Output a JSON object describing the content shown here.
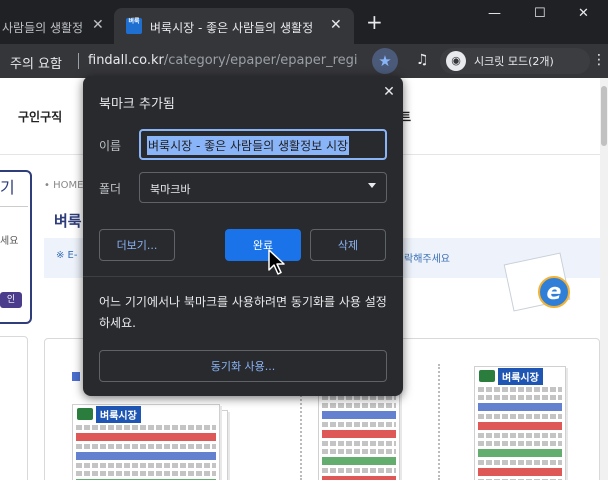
{
  "tabs": [
    {
      "title": "사람들의 생활정",
      "active": false
    },
    {
      "title": "벼룩시장 - 좋은 사람들의 생활정",
      "active": true,
      "favicon_text": "벼룩"
    }
  ],
  "toolbar": {
    "security_label": "주의 요함",
    "url_host": "findall.co.kr",
    "url_path": "/category/epaper/epaper_regi",
    "profile_label": "시크릿 모드(2개)"
  },
  "page": {
    "nav_job": "구인구직",
    "nav_event": "트",
    "breadcrumb": "• HOME",
    "section_title": "벼룩",
    "notice_prefix": "※ E-",
    "notice_suffix": "락해주세요",
    "login_title": "기",
    "login_text1": "세요",
    "login_btn": "인",
    "paper_title": "벼룩시장"
  },
  "bubble": {
    "title": "북마크 추가됨",
    "name_label": "이름",
    "name_value": "벼룩시장 - 좋은 사람들의 생활정보 시장",
    "folder_label": "폴더",
    "folder_value": "북마크바",
    "more_label": "더보기...",
    "done_label": "완료",
    "remove_label": "삭제",
    "sync_text": "어느 기기에서나 북마크를 사용하려면 동기화를 사용 설정하세요.",
    "sync_button": "동기화 사용..."
  },
  "colors": {
    "bubble_bg": "#292a2d",
    "accent_blue": "#1a73e8",
    "link_blue": "#8ab4f8",
    "site_navy": "#2f3d7a"
  }
}
